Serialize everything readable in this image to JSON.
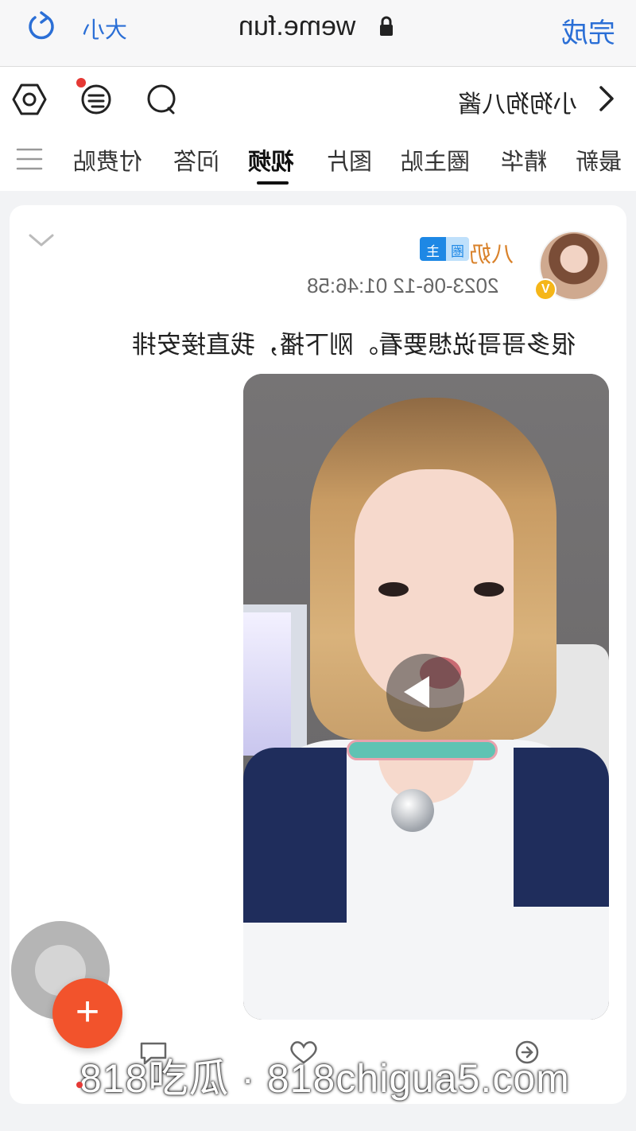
{
  "browser": {
    "done_label": "完成",
    "url": "weme.fun",
    "text_size_label": "大小"
  },
  "header": {
    "title": "小狗狗八酱"
  },
  "tabs": [
    {
      "label": "最新"
    },
    {
      "label": "精华"
    },
    {
      "label": "圈主贴"
    },
    {
      "label": "图片"
    },
    {
      "label": "视频"
    },
    {
      "label": "问答"
    },
    {
      "label": "付费贴"
    }
  ],
  "active_tab": "视频",
  "post": {
    "author": "八奶",
    "badge_main": "主",
    "badge_sub": "圈",
    "verified_mark": "V",
    "timestamp": "2023-06-12 01:46:58",
    "text": "很多哥哥说想要看。刚下播，我直接安排"
  },
  "fab_label": "+",
  "watermark": "818吃瓜 · 818chigua5.com",
  "colors": {
    "accent_blue": "#2b6fd6",
    "author_orange": "#d9822b",
    "fab_orange": "#f2532c"
  }
}
